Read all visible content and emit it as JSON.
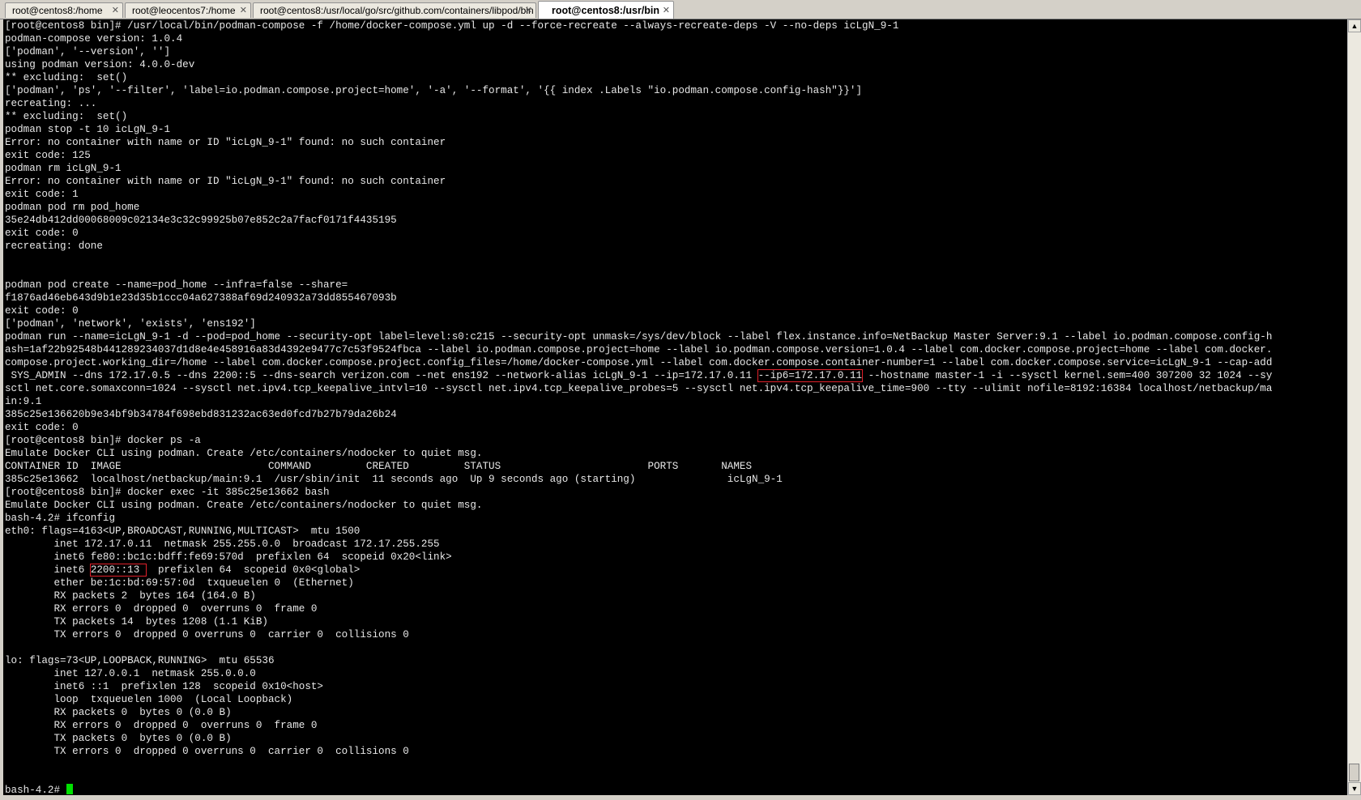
{
  "tabs": [
    {
      "label": "root@centos8:/home",
      "active": false
    },
    {
      "label": "root@leocentos7:/home",
      "active": false
    },
    {
      "label": "root@centos8:/usr/local/go/src/github.com/containers/libpod/bin",
      "active": false
    },
    {
      "label": "root@centos8:/usr/bin",
      "active": true
    }
  ],
  "tab_close_glyph": "✕",
  "terminal": {
    "lines": [
      "[root@centos8 bin]# /usr/local/bin/podman-compose -f /home/docker-compose.yml up -d --force-recreate --always-recreate-deps -V --no-deps icLgN_9-1",
      "podman-compose version: 1.0.4",
      "['podman', '--version', '']",
      "using podman version: 4.0.0-dev",
      "** excluding:  set()",
      "['podman', 'ps', '--filter', 'label=io.podman.compose.project=home', '-a', '--format', '{{ index .Labels \"io.podman.compose.config-hash\"}}']",
      "recreating: ...",
      "** excluding:  set()",
      "podman stop -t 10 icLgN_9-1",
      "Error: no container with name or ID \"icLgN_9-1\" found: no such container",
      "exit code: 125",
      "podman rm icLgN_9-1",
      "Error: no container with name or ID \"icLgN_9-1\" found: no such container",
      "exit code: 1",
      "podman pod rm pod_home",
      "35e24db412dd00068009c02134e3c32c99925b07e852c2a7facf0171f4435195",
      "exit code: 0",
      "recreating: done",
      "",
      "",
      "podman pod create --name=pod_home --infra=false --share=",
      "f1876ad46eb643d9b1e23d35b1ccc04a627388af69d240932a73dd855467093b",
      "exit code: 0",
      "['podman', 'network', 'exists', 'ens192']",
      "podman run --name=icLgN_9-1 -d --pod=pod_home --security-opt label=level:s0:c215 --security-opt unmask=/sys/dev/block --label flex.instance.info=NetBackup Master Server:9.1 --label io.podman.compose.config-h",
      "ash=1af22b92548b441289234037d1d8e4e458916a83d4392e9477c7c53f9524fbca --label io.podman.compose.project=home --label io.podman.compose.version=1.0.4 --label com.docker.compose.project=home --label com.docker.",
      "compose.project.working_dir=/home --label com.docker.compose.project.config_files=/home/docker-compose.yml --label com.docker.compose.container-number=1 --label com.docker.compose.service=icLgN_9-1 --cap-add",
      " SYS_ADMIN --dns 172.17.0.5 --dns 2200::5 --dns-search verizon.com --net ens192 --network-alias icLgN_9-1 --ip=172.17.0.11 ",
      "sctl net.core.somaxconn=1024 --sysctl net.ipv4.tcp_keepalive_intvl=10 --sysctl net.ipv4.tcp_keepalive_probes=5 --sysctl net.ipv4.tcp_keepalive_time=900 --tty --ulimit nofile=8192:16384 localhost/netbackup/ma",
      "in:9.1",
      "385c25e136620b9e34bf9b34784f698ebd831232ac63ed0fcd7b27b79da26b24",
      "exit code: 0",
      "[root@centos8 bin]# docker ps -a",
      "Emulate Docker CLI using podman. Create /etc/containers/nodocker to quiet msg.",
      "CONTAINER ID  IMAGE                        COMMAND         CREATED         STATUS                        PORTS       NAMES",
      "385c25e13662  localhost/netbackup/main:9.1  /usr/sbin/init  11 seconds ago  Up 9 seconds ago (starting)               icLgN_9-1",
      "[root@centos8 bin]# docker exec -it 385c25e13662 bash",
      "Emulate Docker CLI using podman. Create /etc/containers/nodocker to quiet msg.",
      "bash-4.2# ifconfig",
      "eth0: flags=4163<UP,BROADCAST,RUNNING,MULTICAST>  mtu 1500",
      "        inet 172.17.0.11  netmask 255.255.0.0  broadcast 172.17.255.255",
      "        inet6 fe80::bc1c:bdff:fe69:570d  prefixlen 64  scopeid 0x20<link>",
      "        inet6 ",
      "        ether be:1c:bd:69:57:0d  txqueuelen 0  (Ethernet)",
      "        RX packets 2  bytes 164 (164.0 B)",
      "        RX errors 0  dropped 0  overruns 0  frame 0",
      "        TX packets 14  bytes 1208 (1.1 KiB)",
      "        TX errors 0  dropped 0 overruns 0  carrier 0  collisions 0",
      "",
      "lo: flags=73<UP,LOOPBACK,RUNNING>  mtu 65536",
      "        inet 127.0.0.1  netmask 255.0.0.0",
      "        inet6 ::1  prefixlen 128  scopeid 0x10<host>",
      "        loop  txqueuelen 1000  (Local Loopback)",
      "        RX packets 0  bytes 0 (0.0 B)",
      "        RX errors 0  dropped 0  overruns 0  frame 0",
      "        TX packets 0  bytes 0 (0.0 B)",
      "        TX errors 0  dropped 0 overruns 0  carrier 0  collisions 0",
      "",
      "",
      "bash-4.2# "
    ],
    "highlight_ip6_text": "--ip6=172.17.0.11",
    "highlight_ip6_after": " --hostname master-1 -i --sysctl kernel.sem=400 307200 32 1024 --sy",
    "highlight_inet6_text": "2200::13 ",
    "highlight_inet6_after": "  prefixlen 64  scopeid 0x0<global>"
  },
  "scrollbar": {
    "up_glyph": "▲",
    "down_glyph": "▼"
  }
}
